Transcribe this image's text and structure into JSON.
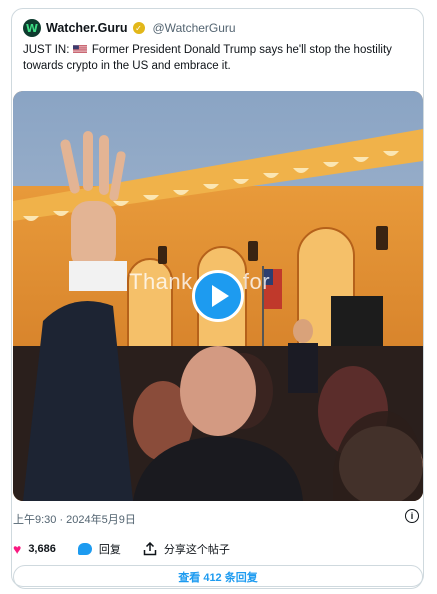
{
  "tweet": {
    "author": {
      "display_name": "Watcher.Guru",
      "handle": "@WatcherGuru",
      "avatar_glyph": "W",
      "verified_glyph": "✓",
      "verified_color": "#e2b719"
    },
    "text": {
      "prefix": "JUST IN:",
      "body": "Former President Donald Trump says he'll stop the hostility towards crypto in the US and embrace it."
    },
    "video": {
      "overlay_caption": "Thank you for",
      "play_icon": "play-icon"
    },
    "timestamp": "上午9:30 · 2024年5月9日",
    "info_glyph": "i",
    "actions": {
      "like_count": "3,686",
      "like_glyph": "♥",
      "reply_label": "回复",
      "share_label": "分享这个帖子"
    },
    "replies_button": "查看 412 条回复"
  },
  "colors": {
    "accent": "#1d9bf0",
    "like": "#f91880",
    "muted_text": "#536471",
    "border": "#cfd9de"
  }
}
